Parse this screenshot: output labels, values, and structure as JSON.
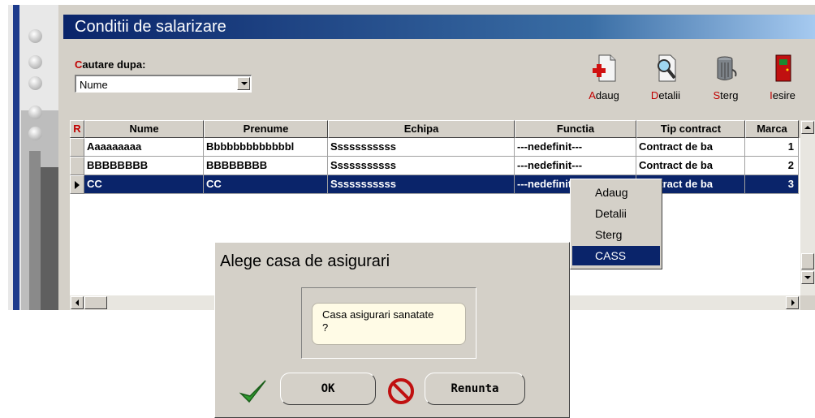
{
  "window": {
    "title": "Conditii de salarizare"
  },
  "search": {
    "label_hotkey": "C",
    "label_rest": "autare dupa:",
    "value": "Nume"
  },
  "toolbar": [
    {
      "hotkey": "A",
      "rest": "daug",
      "icon": "add-document-icon"
    },
    {
      "hotkey": "D",
      "rest": "etalii",
      "icon": "magnifier-document-icon"
    },
    {
      "hotkey": "S",
      "rest": "terg",
      "icon": "trash-can-icon"
    },
    {
      "hotkey": "I",
      "rest": "esire",
      "icon": "exit-door-icon"
    }
  ],
  "grid": {
    "corner": "R",
    "columns": [
      "Nume",
      "Prenume",
      "Echipa",
      "Functia",
      "Tip contract",
      "Marca"
    ],
    "rows": [
      {
        "nume": "Aaaaaaaaa",
        "prenume": "Bbbbbbbbbbbbbl",
        "echipa": "Sssssssssss",
        "functia": "---nedefinit---",
        "tip": "Contract de ba",
        "marca": "1"
      },
      {
        "nume": "BBBBBBBB",
        "prenume": "BBBBBBBB",
        "echipa": "Sssssssssss",
        "functia": "---nedefinit---",
        "tip": "Contract de ba",
        "marca": "2"
      },
      {
        "nume": "CC",
        "prenume": "CC",
        "echipa": "Sssssssssss",
        "functia": "---nedefinit---",
        "tip": "Contract de ba",
        "marca": "3"
      }
    ]
  },
  "context_menu": [
    "Adaug",
    "Detalii",
    "Sterg",
    "CASS"
  ],
  "dialog": {
    "title": "Alege casa de asigurari",
    "message_line1": "Casa asigurari sanatate",
    "message_line2": "?",
    "ok_label": "OK",
    "cancel_label": "Renunta"
  },
  "colors": {
    "title_bar": "#0a246a",
    "selection": "#0a246a",
    "hotkey": "#c00000",
    "face": "#d4d0c8"
  }
}
